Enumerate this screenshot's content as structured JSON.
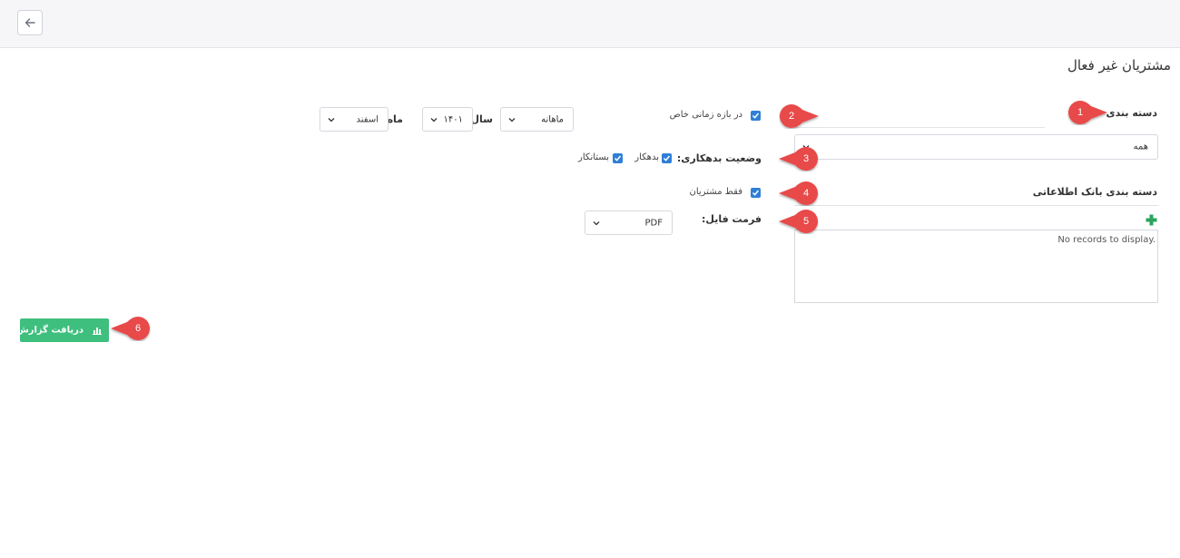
{
  "page": {
    "title": "مشتریان غیر فعال"
  },
  "header": {
    "back_icon": "arrow-left-icon"
  },
  "filters": {
    "grouping_label": "دسته بندی",
    "grouping_value": "همه",
    "time_range_label": "در بازه زمانی خاص",
    "period_value": "ماهانه",
    "year_label": "سال",
    "year_value": "۱۴۰۱",
    "month_label": "ماه",
    "month_value": "اسفند",
    "debt_status_label": "وضعیت بدهکاری:",
    "debtor_label": "بدهکار",
    "creditor_label": "بستانکار",
    "db_grouping_label": "دسته بندی بانک اطلاعاتی",
    "only_customers_label": "فقط مشتریان",
    "empty_list_text": "No records to display.",
    "file_format_label": "فرمت فایل:",
    "file_format_value": "PDF"
  },
  "actions": {
    "get_report_label": "دریافت گزارش"
  },
  "markers": [
    "1",
    "2",
    "3",
    "4",
    "5",
    "6"
  ],
  "colors": {
    "accent": "#2f7fd6",
    "button": "#3fbf7e",
    "marker": "#e84848",
    "plus": "#2aa55c"
  }
}
